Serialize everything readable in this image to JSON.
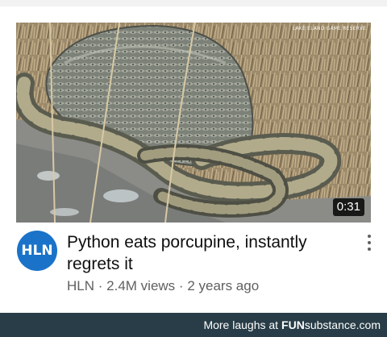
{
  "video": {
    "thumbnail_alt": "python-eating-porcupine-thumbnail",
    "watermark": "LAKE ELAND GAME RESERVE",
    "duration": "0:31",
    "title": "Python eats porcupine, instantly regrets it",
    "channel": "HLN",
    "views": "2.4M views",
    "age": "2 years ago",
    "separator": "·",
    "menu_icon": "more-vert-icon"
  },
  "channel_avatar": {
    "text": "HLN",
    "color": "#1a73c9"
  },
  "footer": {
    "prefix": "More laughs at",
    "brand_fun": "FUN",
    "brand_sub": "substance",
    "brand_tld": ".com",
    "background": "#283d47"
  }
}
